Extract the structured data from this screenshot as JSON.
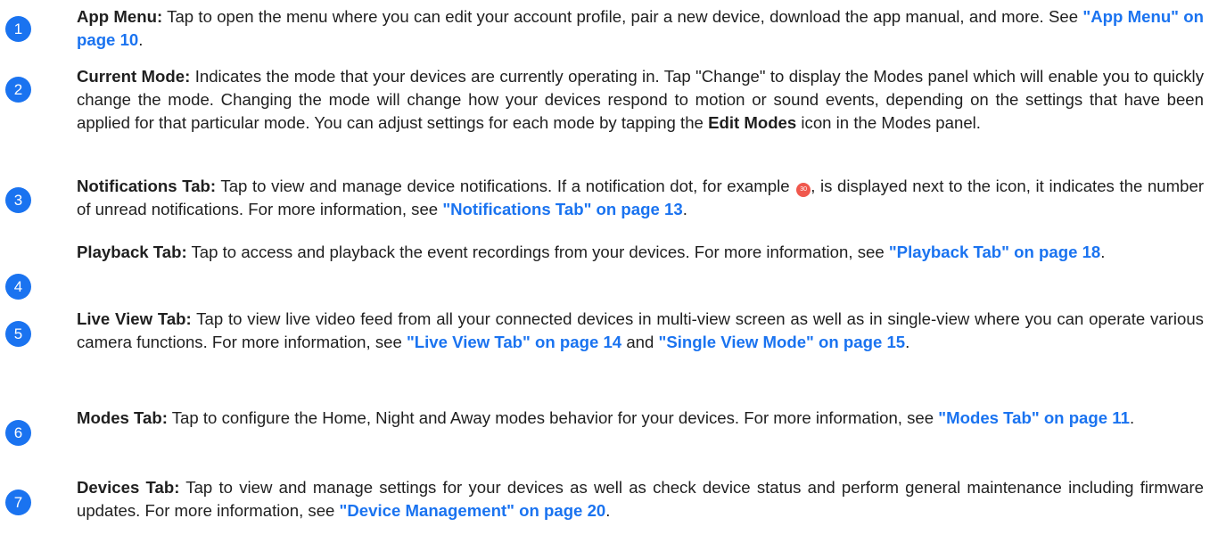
{
  "items": [
    {
      "number": "1",
      "title": "App Menu:",
      "text": " Tap to open the menu where you can edit your account profile, pair a new device, download the app manual, and more. See ",
      "link": "\"App Menu\" on page 10",
      "end": "."
    },
    {
      "number": "2",
      "title": "Current Mode:",
      "text": " Indicates the mode that your devices are currently operating in. Tap \"Change\" to display the Modes panel which will enable you to quickly change the mode. Changing the mode will change how your devices respond to motion or sound events, depending on the settings that have been applied for that particular mode. You can adjust settings for each mode by tapping the ",
      "bold": "Edit Modes",
      "text2": " icon in the Modes panel."
    },
    {
      "number": "3",
      "title": "Notifications Tab:",
      "text": " Tap to view and manage device notifications. If a notification dot, for example ",
      "dot": "30",
      "text2": ", is displayed next to the icon, it indicates the number of unread notifications. For more information, see ",
      "link": "\"Notifications Tab\" on page 13",
      "end": "."
    },
    {
      "number": "4",
      "title": "Playback Tab:",
      "text": " Tap to access and playback the event recordings from your devices. For more information, see ",
      "link": "\"Playback Tab\" on page 18",
      "end": "."
    },
    {
      "number": "5",
      "title": "Live View Tab:",
      "text": " Tap to view live video feed from all your connected devices in multi-view screen as well as in single-view where you can operate various camera functions. For more information, see ",
      "link": "\"Live View Tab\" on page 14",
      "mid": " and ",
      "link2": "\"Single View Mode\" on page 15",
      "end": "."
    },
    {
      "number": "6",
      "title": "Modes Tab:",
      "text": " Tap to configure the Home, Night and Away modes behavior for your devices. For more information, see ",
      "link": "\"Modes Tab\" on page 11",
      "end": "."
    },
    {
      "number": "7",
      "title": "Devices Tab:",
      "text": " Tap to view and manage settings for your devices as well as check device status and perform general maintenance including firmware updates. For more information, see ",
      "link": "\"Device Management\" on page 20",
      "end": "."
    }
  ],
  "colors": {
    "badge": "#1a73f0",
    "link": "#1a73f0",
    "dot": "#f0584d",
    "text": "#1f1f1f"
  }
}
